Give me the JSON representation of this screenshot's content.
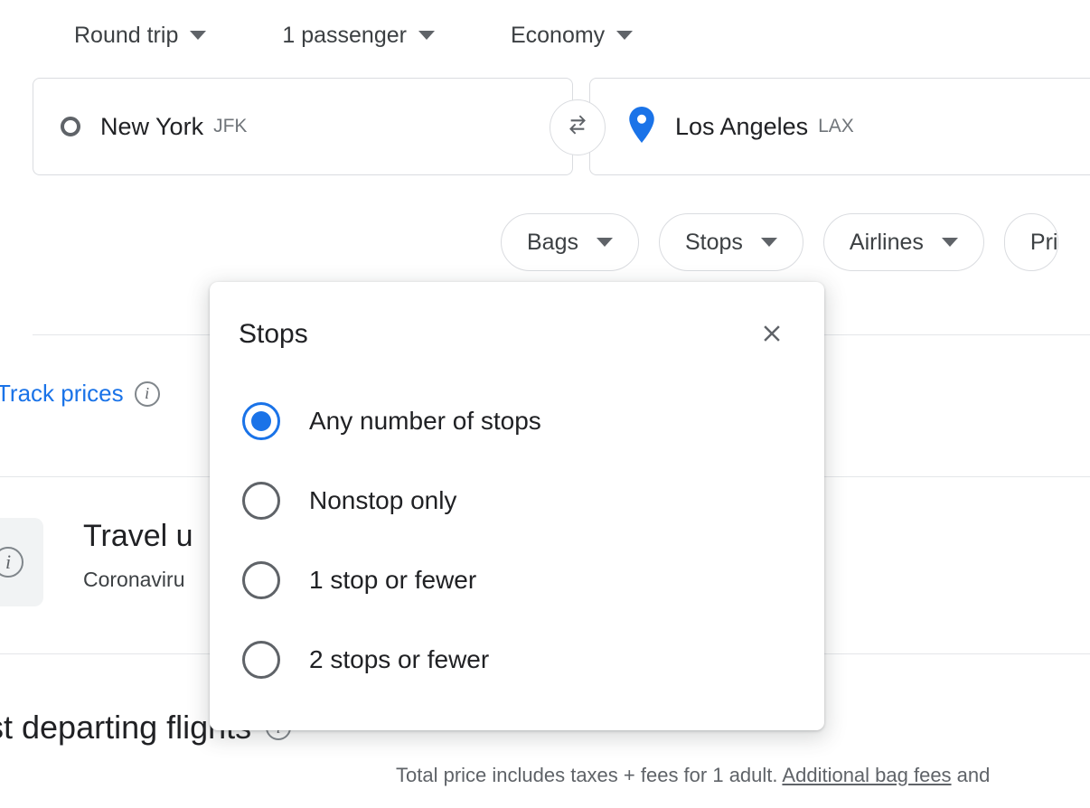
{
  "top_options": [
    {
      "label": "Round trip",
      "icon": "chevron-down-icon"
    },
    {
      "label": "1 passenger",
      "icon": "chevron-down-icon"
    },
    {
      "label": "Economy",
      "icon": "chevron-down-icon"
    }
  ],
  "search": {
    "origin": {
      "city": "New York",
      "code": "JFK",
      "icon": "circle-outline-icon"
    },
    "destination": {
      "city": "Los Angeles",
      "code": "LAX",
      "icon": "map-pin-icon"
    },
    "swap_icon": "swap-arrows-icon"
  },
  "filter_chips": [
    {
      "label": "Bags"
    },
    {
      "label": "Stops"
    },
    {
      "label": "Airlines"
    },
    {
      "label": "Pri"
    }
  ],
  "background": {
    "track_prices_label": "Track prices",
    "track_prices_info_icon": "info-icon",
    "travel_updates_title": "Travel u",
    "travel_updates_subtitle": "Coronaviru",
    "travel_updates_icon": "info-icon",
    "best_flights_heading": "st departing flights",
    "best_flights_info_icon": "info-icon",
    "price_note_text": "Total price includes taxes + fees for 1 adult. ",
    "price_note_link": "Additional bag fees",
    "price_note_tail": " and"
  },
  "modal": {
    "title": "Stops",
    "close_icon": "close-icon",
    "options": [
      {
        "label": "Any number of stops",
        "selected": true
      },
      {
        "label": "Nonstop only",
        "selected": false
      },
      {
        "label": "1 stop or fewer",
        "selected": false
      },
      {
        "label": "2 stops or fewer",
        "selected": false
      }
    ]
  },
  "colors": {
    "accent_blue": "#1a73e8",
    "text_primary": "#202124",
    "text_secondary": "#5f6368",
    "border": "#dadce0"
  }
}
